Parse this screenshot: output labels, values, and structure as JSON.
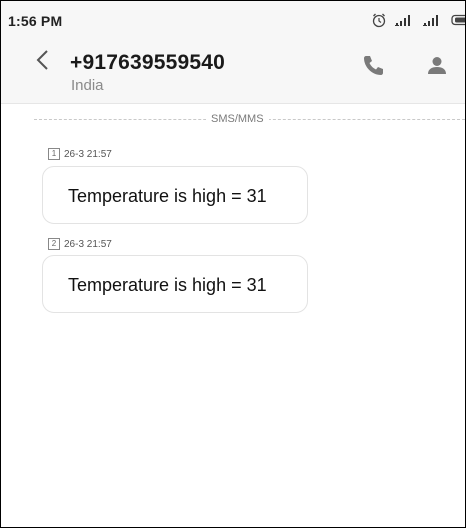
{
  "status_bar": {
    "time": "1:56 PM",
    "icons": [
      "alarm-clock-icon",
      "signal-icon",
      "signal-icon",
      "battery-icon"
    ]
  },
  "header": {
    "back_icon": "chevron-left-icon",
    "contact_number": "+917639559540",
    "contact_location": "India",
    "call_icon": "phone-icon",
    "contact_icon": "person-icon"
  },
  "thread": {
    "channel_label": "SMS/MMS",
    "messages": [
      {
        "sim": "1",
        "timestamp": "26-3 21:57",
        "text": "Temperature is high = 31"
      },
      {
        "sim": "2",
        "timestamp": "26-3 21:57",
        "text": "Temperature is high = 31"
      }
    ]
  },
  "colors": {
    "header_bg": "#f7f7f7",
    "accent_gray": "#8a8a8a",
    "bubble_border": "#e3e3e3"
  }
}
